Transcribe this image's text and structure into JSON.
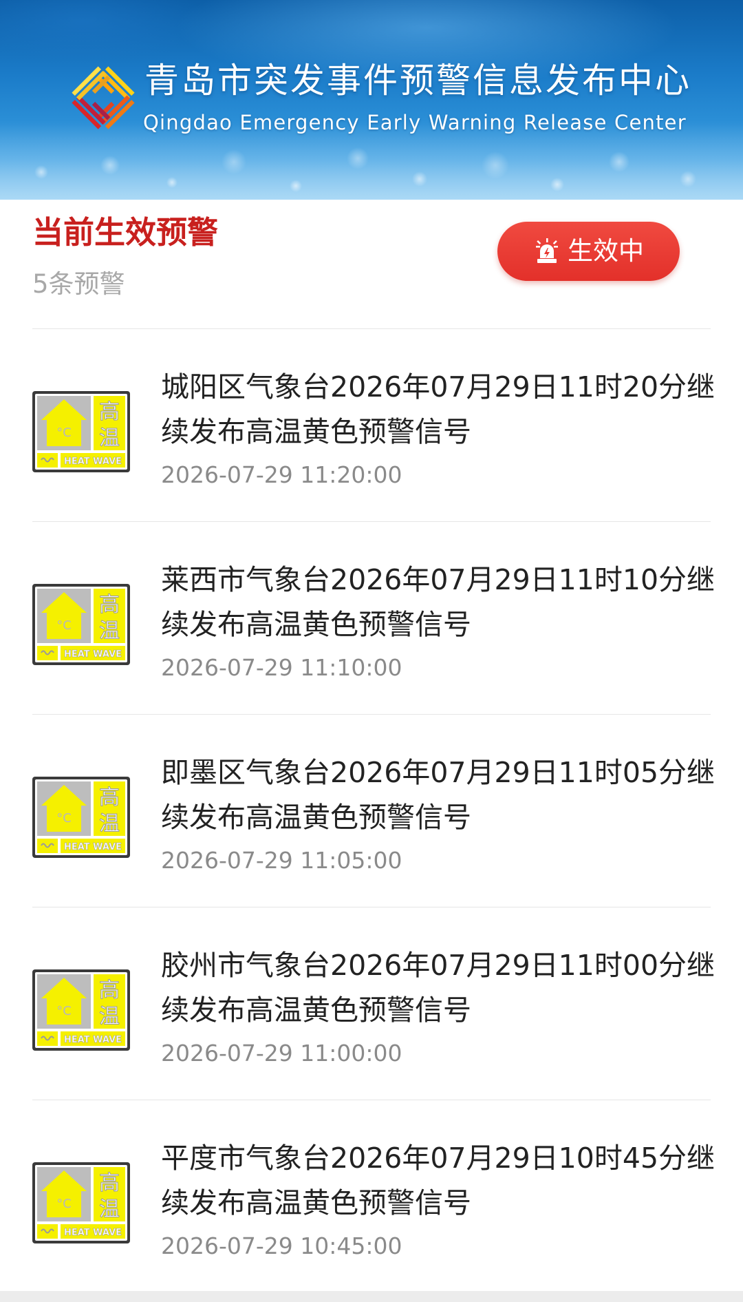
{
  "banner": {
    "title": "青岛市突发事件预警信息发布中心",
    "subtitle": "Qingdao Emergency Early Warning Release Center",
    "logo_icon": "qingdao-emergency-logo"
  },
  "section": {
    "title": "当前生效预警",
    "count": "5条预警",
    "status_label": "生效中",
    "status_icon": "alarm-light-icon",
    "accent_color": "#c8201e",
    "pill_color": "#e8362e"
  },
  "warning_icon": {
    "name": "heat-wave-yellow-warning-icon",
    "cn_text_top": "高",
    "cn_text_bottom": "温",
    "en_text": "HEAT WAVE",
    "symbol": "°C",
    "color": "#f5f000"
  },
  "warnings": [
    {
      "title": "城阳区气象台2026年07月29日11时20分继续发布高温黄色预警信号",
      "time": "2026-07-29 11:20:00"
    },
    {
      "title": "莱西市气象台2026年07月29日11时10分继续发布高温黄色预警信号",
      "time": "2026-07-29 11:10:00"
    },
    {
      "title": "即墨区气象台2026年07月29日11时05分继续发布高温黄色预警信号",
      "time": "2026-07-29 11:05:00"
    },
    {
      "title": "胶州市气象台2026年07月29日11时00分继续发布高温黄色预警信号",
      "time": "2026-07-29 11:00:00"
    },
    {
      "title": "平度市气象台2026年07月29日10时45分继续发布高温黄色预警信号",
      "time": "2026-07-29 10:45:00"
    }
  ]
}
